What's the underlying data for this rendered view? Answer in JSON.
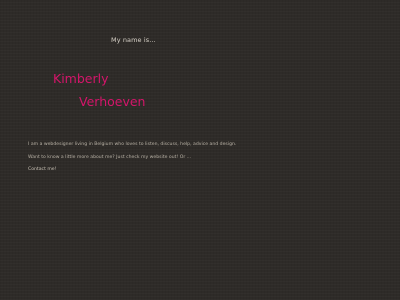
{
  "header": {
    "intro": "My name is..."
  },
  "name": {
    "first": "Kimberly",
    "last": "Verhoeven"
  },
  "bio": {
    "line1": "I am a webdesigner living in Belgium who loves to listen, discuss, help, advice and design.",
    "line2": "Want to know a little more about me? Just check my website out! Or ...",
    "contact_label": "Contact me!"
  },
  "colors": {
    "background": "#2e2b28",
    "accent": "#d4156a",
    "text": "#b9b2a6"
  }
}
